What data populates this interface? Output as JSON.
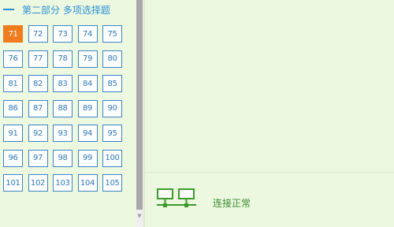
{
  "section": {
    "title": "第二部分 多项选择题"
  },
  "questions": [
    "71",
    "72",
    "73",
    "74",
    "75",
    "76",
    "77",
    "78",
    "79",
    "80",
    "81",
    "82",
    "83",
    "84",
    "85",
    "86",
    "87",
    "88",
    "89",
    "90",
    "91",
    "92",
    "93",
    "94",
    "95",
    "96",
    "97",
    "98",
    "99",
    "100",
    "101",
    "102",
    "103",
    "104",
    "105"
  ],
  "current_question": "71",
  "status": {
    "icon": "network-icon",
    "text": "连接正常"
  },
  "colors": {
    "background": "#ecf8df",
    "button_border": "#3a84c6",
    "button_text": "#2d77b8",
    "current_bg": "#f07c1e",
    "header": "#2b8fd8",
    "status_text": "#3d8a32"
  }
}
